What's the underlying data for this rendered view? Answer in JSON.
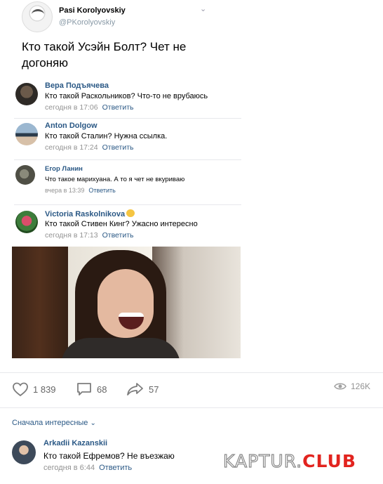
{
  "tweet": {
    "display_name": "Pasi Korolyovskiy",
    "handle": "@PKorolyovskiy",
    "text": "Кто такой Усэйн Болт? Чет не догоняю"
  },
  "comments": [
    {
      "name": "Вера Подъячева",
      "text": "Кто такой Раскольников? Что-то не врубаюсь",
      "time": "сегодня в 17:06",
      "reply": "Ответить"
    },
    {
      "name": "Anton Dolgow",
      "text": "Кто такой Сталин? Нужна ссылка.",
      "time": "сегодня в 17:24",
      "reply": "Ответить"
    },
    {
      "name": "Егор Ланин",
      "text": "Что такое марихуана. А то я чет не вкуриваю",
      "time": "вчера в 13:39",
      "reply": "Ответить"
    },
    {
      "name": "Victoria Raskolnikova",
      "text": "Кто такой Стивен Кинг? Ужасно интересно",
      "time": "сегодня в 17:13",
      "reply": "Ответить"
    }
  ],
  "actions": {
    "likes": "1 839",
    "comments": "68",
    "shares": "57",
    "views": "126K"
  },
  "sort_label": "Сначала интересные",
  "last_comment": {
    "name": "Arkadii Kazanskii",
    "text": "Кто такой Ефремов? Не въезжаю",
    "time": "сегодня в 6:44",
    "reply": "Ответить"
  },
  "watermark": {
    "part1": "KAPTUR.",
    "part2": "CLUB"
  },
  "colors": {
    "link": "#2a5885",
    "meta": "#939393",
    "accent": "#e2241f"
  }
}
